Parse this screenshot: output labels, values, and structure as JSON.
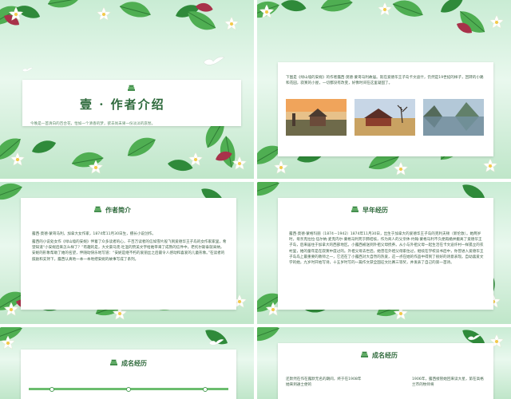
{
  "slides": [
    {
      "id": "title-slide",
      "title": "壹 · 作者介绍",
      "subtitle": "今晚是一首清白的百合花，恰如一个清香的梦，欲去尚未果一份淡淡的哀愁。"
    },
    {
      "id": "intro-photos",
      "paragraph": "下图是《绿山墙的安妮》的作者露西·莫德·蒙哥马利故居。就在爱德华王子岛卡文迪什，仍然是19世纪的样子，回转的小路和花园，寂寞的小屋，一切都没有改变，好像时间在这里凝固了。"
    },
    {
      "id": "author-intro",
      "section_title": "作者简介",
      "paragraphs": [
        "露西·莫德·蒙哥马利，加拿大女作家，1874年11月30日生，擅长小说创作。",
        "露西的小说处女作《绿山墙的安妮》伴着了众多读者的心，千百万读者的信如雪片般飞到爱德华王子岛的女作家家里，希望知道“小安妮后来怎么样了？”有趣的是，大文豪马克·吐温的赞美文字给她带来了成熟的信件中，老托尔斯泰就采纳，安妮的形象帮助了她的名望，伴随动快乐地写道：“安妮是继不朽的爱丽丝之后最令人感动和喜爱的儿童形象。”在读者的鼓励和支持下，露西认真地一本一本地把安妮的故事写成了系列。"
      ]
    },
    {
      "id": "early-life",
      "section_title": "早年经历",
      "paragraph": "露西·莫德·蒙格玛丽（1874－1942）1874年11月30日，出生于加拿大的爱德华王子岛的克利夫顿（新伦敦）。她两岁时，母亲克拉拉·伍尔纳·麦克内尔·蒙格马利死于肺结核，作为商人的父亲休·约翰·蒙格马利不久便再婚并搬离了爱德华王子岛，后来居住于加拿大的西部地区。小露西被送到外祖父母抚养。从小与外祖父母一起生活在卡文迪许村一样孤立的农村里，她的童年是在寂寞中度过的。外祖父母去世后，她曾在外祖父母家住过，继续在学校读书后中，你曾进入爱德华王子岛岛上最重要的教师之一，它还在了小露西对大自然的热爱，这一点在她的作品中得到了很好的诗意表现。自幼喜爱文学的她，九岁时开始写诗，十五岁时写的一篇作文获全国征文比赛三等奖，并发表了自己的第一首诗。"
    },
    {
      "id": "success-timeline",
      "section_title": "成名经历"
    },
    {
      "id": "success-detail",
      "section_title": "成名经历",
      "text_left": "还默然在作在露默无名的期间，终于在1908年她来到通士便的",
      "text_right": "1906年，露西接管她回来读大星，第在高格兰市的牧师将"
    }
  ],
  "colors": {
    "primary_green": "#2e6a3c",
    "accent_green": "#6bbd6e",
    "background_mint": "#d6f2de"
  },
  "icons": {
    "section_icon": "book-stack-icon",
    "bird": "dove-icon",
    "flower": "white-lily-icon"
  }
}
